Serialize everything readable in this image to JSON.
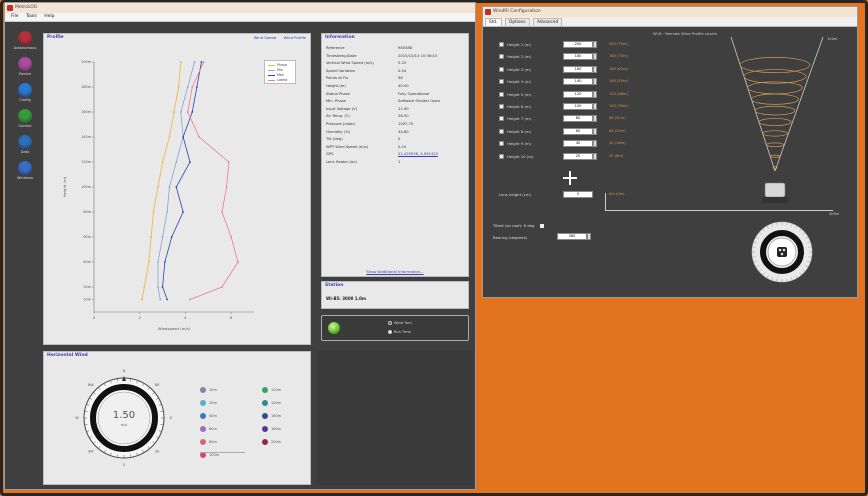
{
  "left_window": {
    "title": "MetroLOG",
    "menu": [
      "File",
      "Tools",
      "Help"
    ],
    "toolbar": [
      {
        "label": "Autonomous",
        "color": "#b8303c",
        "icon": "power-icon"
      },
      {
        "label": "Device",
        "color": "#a84ca4",
        "icon": "device-icon"
      },
      {
        "label": "Config",
        "color": "#2c7ad0",
        "icon": "gear-icon"
      },
      {
        "label": "Control",
        "color": "#3a9a3e",
        "icon": "control-icon"
      },
      {
        "label": "Data",
        "color": "#2e6fb8",
        "icon": "data-icon"
      },
      {
        "label": "Windows",
        "color": "#3c6cc8",
        "icon": "windows-icon"
      }
    ],
    "profile": {
      "title": "Profile",
      "header_links": [
        "Wind Speed",
        "Wind Profile"
      ],
      "xlabel": "Windspeed (m/s)",
      "ylabel": "Height (m)",
      "legend": [
        "Phase",
        "Min",
        "Max",
        "Latest"
      ],
      "y_ticks": [
        "200m",
        "180m",
        "160m",
        "140m",
        "120m",
        "100m",
        "80m",
        "60m",
        "40m",
        "20m",
        "10m"
      ],
      "x_ticks": [
        "0",
        "2",
        "4",
        "6"
      ],
      "chart_data": {
        "type": "line",
        "xlabel": "Windspeed (m/s)",
        "ylabel": "Height (m)",
        "xlim": [
          0,
          7
        ],
        "ylim": [
          0,
          200
        ],
        "heights": [
          10,
          20,
          40,
          60,
          80,
          100,
          120,
          140,
          160,
          180,
          200
        ],
        "series": [
          {
            "name": "Phase",
            "color": "#f0b43c",
            "values": [
              2.1,
              2.2,
              2.4,
              2.5,
              2.6,
              2.8,
              3.0,
              3.3,
              3.5,
              3.7,
              3.8
            ]
          },
          {
            "name": "Min",
            "color": "#8ca0d8",
            "values": [
              2.9,
              2.8,
              2.8,
              3.0,
              3.2,
              3.3,
              3.6,
              3.9,
              3.8,
              4.1,
              4.4
            ]
          },
          {
            "name": "Max",
            "color": "#2a48a8",
            "values": [
              3.2,
              3.0,
              3.1,
              3.4,
              3.9,
              3.6,
              4.2,
              3.9,
              4.3,
              4.5,
              4.7
            ]
          },
          {
            "name": "Latest",
            "color": "#f07898",
            "values": [
              4.2,
              5.6,
              6.3,
              6.0,
              5.6,
              5.8,
              5.9,
              4.6,
              4.1,
              4.3,
              4.8
            ]
          }
        ]
      }
    },
    "info": {
      "title": "Information",
      "rows": [
        {
          "k": "Reference",
          "v": "980388"
        },
        {
          "k": "Timestamp/Date",
          "v": "2015/10/14 10:36:43"
        },
        {
          "k": "Vertical Wind Speed (m/s)",
          "v": "0.20"
        },
        {
          "k": "Speed Variation",
          "v": "0.04"
        },
        {
          "k": "Points at Fix",
          "v": "96"
        },
        {
          "k": "Height (m)",
          "v": "40.00"
        },
        {
          "k": "Status Phase",
          "v": "Fully Operational"
        },
        {
          "k": "Min. Phase",
          "v": "Software Shutter Open"
        },
        {
          "k": "Input Voltage (V)",
          "v": "11.90"
        },
        {
          "k": "Air Temp. (C)",
          "v": "28.50"
        },
        {
          "k": "Pressure (mbar)",
          "v": "1007.70"
        },
        {
          "k": "Humidity (%)",
          "v": "44.80"
        },
        {
          "k": "Tilt (deg)",
          "v": "0"
        },
        {
          "k": "WPT Wind Speed (m/s)",
          "v": "0.10"
        },
        {
          "k": "GPS",
          "v": "52.429538, 4.091423",
          "link": true
        },
        {
          "k": "Lens Heater (on)",
          "v": "1"
        }
      ],
      "footer_link": "Show Additional Information..."
    },
    "station": {
      "title": "Station",
      "value": "Wi-B5: 3000 1.0m"
    },
    "status_options": [
      {
        "label": "Wind Turn",
        "on": false
      },
      {
        "label": "Run Time",
        "on": true
      }
    ],
    "wind": {
      "title": "Horizontal Wind",
      "value": "1.50",
      "unit": "m/s",
      "compass_labels": [
        "N",
        "NE",
        "E",
        "SE",
        "S",
        "SW",
        "W",
        "NW"
      ],
      "left_list": [
        {
          "label": "10m",
          "color": "#7a8aa0"
        },
        {
          "label": "20m",
          "color": "#5ab0c8"
        },
        {
          "label": "40m",
          "color": "#3c78c0"
        },
        {
          "label": "60m",
          "color": "#a070b8"
        },
        {
          "label": "80m",
          "color": "#d06878"
        },
        {
          "label": "100m",
          "color": "#d84860"
        }
      ],
      "right_list": [
        {
          "label": "120m",
          "color": "#3aa064"
        },
        {
          "label": "140m",
          "color": "#2c8c8c"
        },
        {
          "label": "160m",
          "color": "#2c4c9c"
        },
        {
          "label": "180m",
          "color": "#4c3c9c"
        },
        {
          "label": "200m",
          "color": "#8c2c4c"
        }
      ]
    }
  },
  "right_window": {
    "title": "WindRI Configuration",
    "tabs": [
      "Std.",
      "Options",
      "Advanced"
    ],
    "chart_title": "Wi-B · Remote Wind Profile Levels",
    "rows": [
      {
        "label": "Height 1 (m)",
        "value": "200"
      },
      {
        "label": "Height 2 (m)",
        "value": "180"
      },
      {
        "label": "Height 3 (m)",
        "value": "160"
      },
      {
        "label": "Height 4 (m)",
        "value": "140"
      },
      {
        "label": "Height 5 (m)",
        "value": "120"
      },
      {
        "label": "Height 6 (m)",
        "value": "100"
      },
      {
        "label": "Height 7 (m)",
        "value": "80"
      },
      {
        "label": "Height 8 (m)",
        "value": "60"
      },
      {
        "label": "Height 9 (m)",
        "value": "40"
      },
      {
        "label": "Height 10 (m)",
        "value": "20"
      }
    ],
    "row_annotations": [
      "200 (75m)",
      "180 (70m)",
      "160 (62m)",
      "140 (55m)",
      "120 (48m)",
      "100 (39m)",
      "80 (31m)",
      "60 (23m)",
      "40 (16m)",
      "20 (8m)"
    ],
    "lens_label": "Lens height (cm)",
    "lens_value": "0",
    "lens_annotation": "0m (0m)",
    "tilt_label": "Tilted (on roof): 6 deg",
    "bearing_label": "Bearing (degrees)",
    "bearing_value": "360",
    "axis_right": "100m",
    "axis_end": "300m"
  }
}
